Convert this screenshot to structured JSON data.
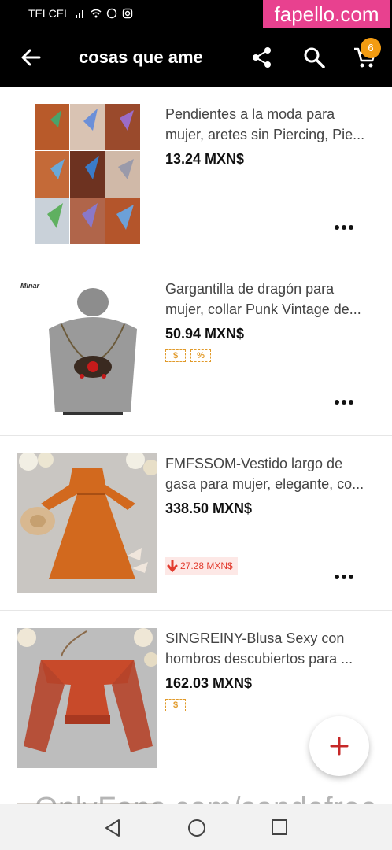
{
  "status_bar": {
    "carrier": "TELCEL"
  },
  "watermarks": {
    "top": "fapello.com",
    "bottom": "OnlyFans.com/sandefree"
  },
  "app_bar": {
    "title": "cosas que ame",
    "cart_count": "6"
  },
  "items": [
    {
      "title_line1": "Pendientes a la moda para",
      "title_line2": "mujer, aretes sin Piercing, Pie...",
      "price": "13.24 MXN$"
    },
    {
      "title_line1": "Gargantilla de dragón para",
      "title_line2": "mujer, collar Punk Vintage de...",
      "price": "50.94 MXN$",
      "thumb_caption": "Minar",
      "badges": [
        "$",
        "%"
      ]
    },
    {
      "title_line1": "FMFSSOM-Vestido largo de",
      "title_line2": "gasa para mujer, elegante, co...",
      "price": "338.50 MXN$",
      "price_drop": "27.28 MXN$"
    },
    {
      "title_line1": "SINGREINY-Blusa Sexy con",
      "title_line2": "hombros descubiertos para ...",
      "price": "162.03 MXN$",
      "badges": [
        "$"
      ]
    }
  ],
  "colors": {
    "accent": "#f39c12",
    "fab_plus": "#c62828",
    "watermark_bg": "#e8418f",
    "coupon": "#e19a2a",
    "drop": "#e23b2e"
  },
  "icons": [
    "back-arrow-icon",
    "share-icon",
    "search-icon",
    "cart-icon",
    "more-options-icon",
    "add-icon",
    "nav-back-icon",
    "nav-home-icon",
    "nav-recents-icon"
  ]
}
